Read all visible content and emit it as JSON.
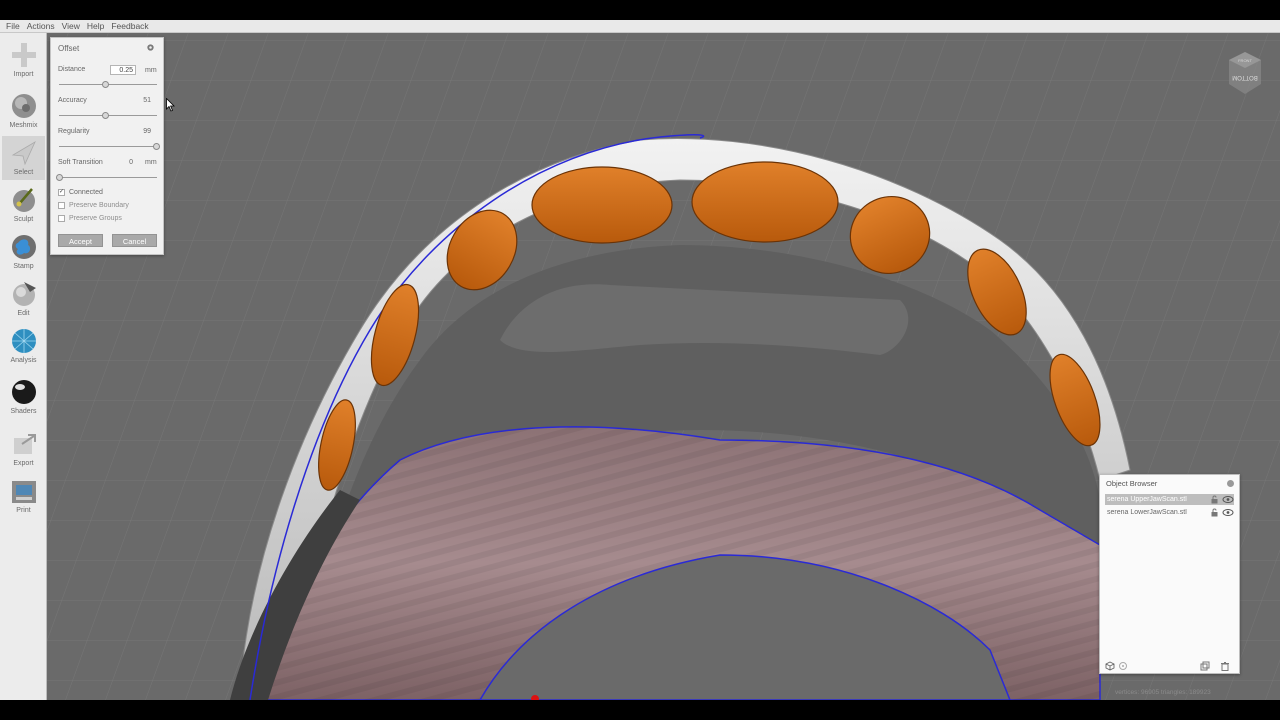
{
  "menu": [
    "File",
    "Actions",
    "View",
    "Help",
    "Feedback"
  ],
  "toolbar": {
    "tools": [
      {
        "label": "Import",
        "icon": "plus-icon"
      },
      {
        "label": "Meshmix",
        "icon": "meshmix-sphere-icon"
      },
      {
        "label": "Select",
        "icon": "select-arrow-icon",
        "active": true
      },
      {
        "label": "Sculpt",
        "icon": "sculpt-brush-icon"
      },
      {
        "label": "Stamp",
        "icon": "stamp-icon"
      },
      {
        "label": "Edit",
        "icon": "edit-sphere-icon"
      },
      {
        "label": "Analysis",
        "icon": "analysis-mesh-icon"
      },
      {
        "label": "Shaders",
        "icon": "shader-ball-icon"
      },
      {
        "label": "Export",
        "icon": "export-arrow-icon"
      },
      {
        "label": "Print",
        "icon": "printer-icon"
      }
    ]
  },
  "offset": {
    "title": "Offset",
    "distance": {
      "label": "Distance",
      "value": "0.25",
      "unit": "mm",
      "fraction": 0.47
    },
    "accuracy": {
      "label": "Accuracy",
      "value": "51",
      "fraction": 0.47
    },
    "regularity": {
      "label": "Regularity",
      "value": "99",
      "fraction": 0.99
    },
    "soft_transition": {
      "label": "Soft Transition",
      "value": "0",
      "unit": "mm",
      "fraction": 0.0
    },
    "checkboxes": [
      {
        "label": "Connected",
        "checked": true
      },
      {
        "label": "Preserve Boundary",
        "checked": false
      },
      {
        "label": "Preserve Groups",
        "checked": false
      }
    ],
    "accept_label": "Accept",
    "cancel_label": "Cancel"
  },
  "object_browser": {
    "title": "Object Browser",
    "objects": [
      {
        "name": "serena UpperJawScan.stl",
        "selected": true
      },
      {
        "name": "serena LowerJawScan.stl",
        "selected": false
      }
    ]
  },
  "status_text": "vertices: 96905 triangles: 189923",
  "viewcube": {
    "face_top": "FRONT",
    "face_main": "BOTTOM"
  },
  "colors": {
    "accent_orange": "#cf6a12",
    "viewport_bg": "#6a6a6a",
    "boundary_blue": "#2a2ad6",
    "gum_pink": "#9a7f82"
  }
}
